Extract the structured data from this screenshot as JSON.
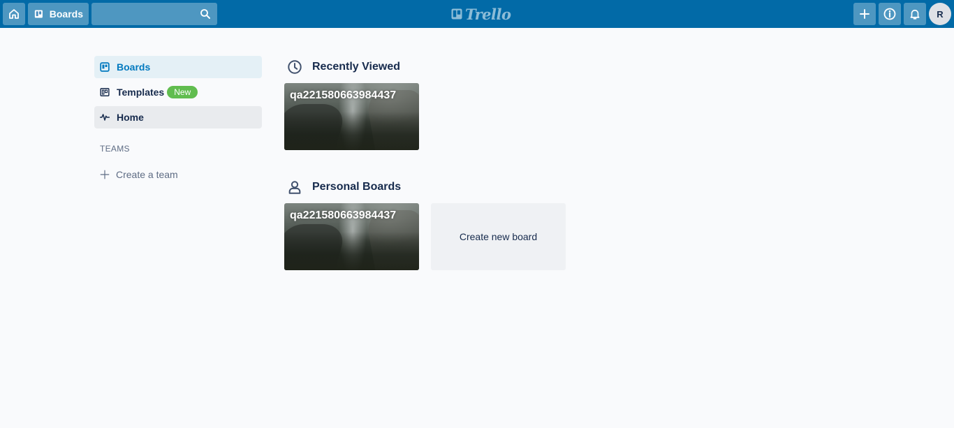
{
  "header": {
    "boards_label": "Boards",
    "search": {
      "value": "",
      "placeholder": ""
    },
    "logo_text": "Trello",
    "avatar_initial": "R",
    "color": "#026aa7"
  },
  "sidebar": {
    "items": [
      {
        "label": "Boards",
        "icon": "board-icon",
        "active": true
      },
      {
        "label": "Templates",
        "icon": "template-icon",
        "badge": "New"
      },
      {
        "label": "Home",
        "icon": "activity-icon"
      }
    ],
    "teams_heading": "TEAMS",
    "create_team_label": "Create a team"
  },
  "main": {
    "recently_viewed": {
      "title": "Recently Viewed",
      "icon": "clock-icon",
      "boards": [
        {
          "name": "qa221580663984437"
        }
      ]
    },
    "personal_boards": {
      "title": "Personal Boards",
      "icon": "person-icon",
      "boards": [
        {
          "name": "qa221580663984437"
        }
      ],
      "create_label": "Create new board"
    }
  },
  "colors": {
    "accent": "#0079bf",
    "new_badge": "#61bd4f",
    "background": "#f9fafc"
  }
}
